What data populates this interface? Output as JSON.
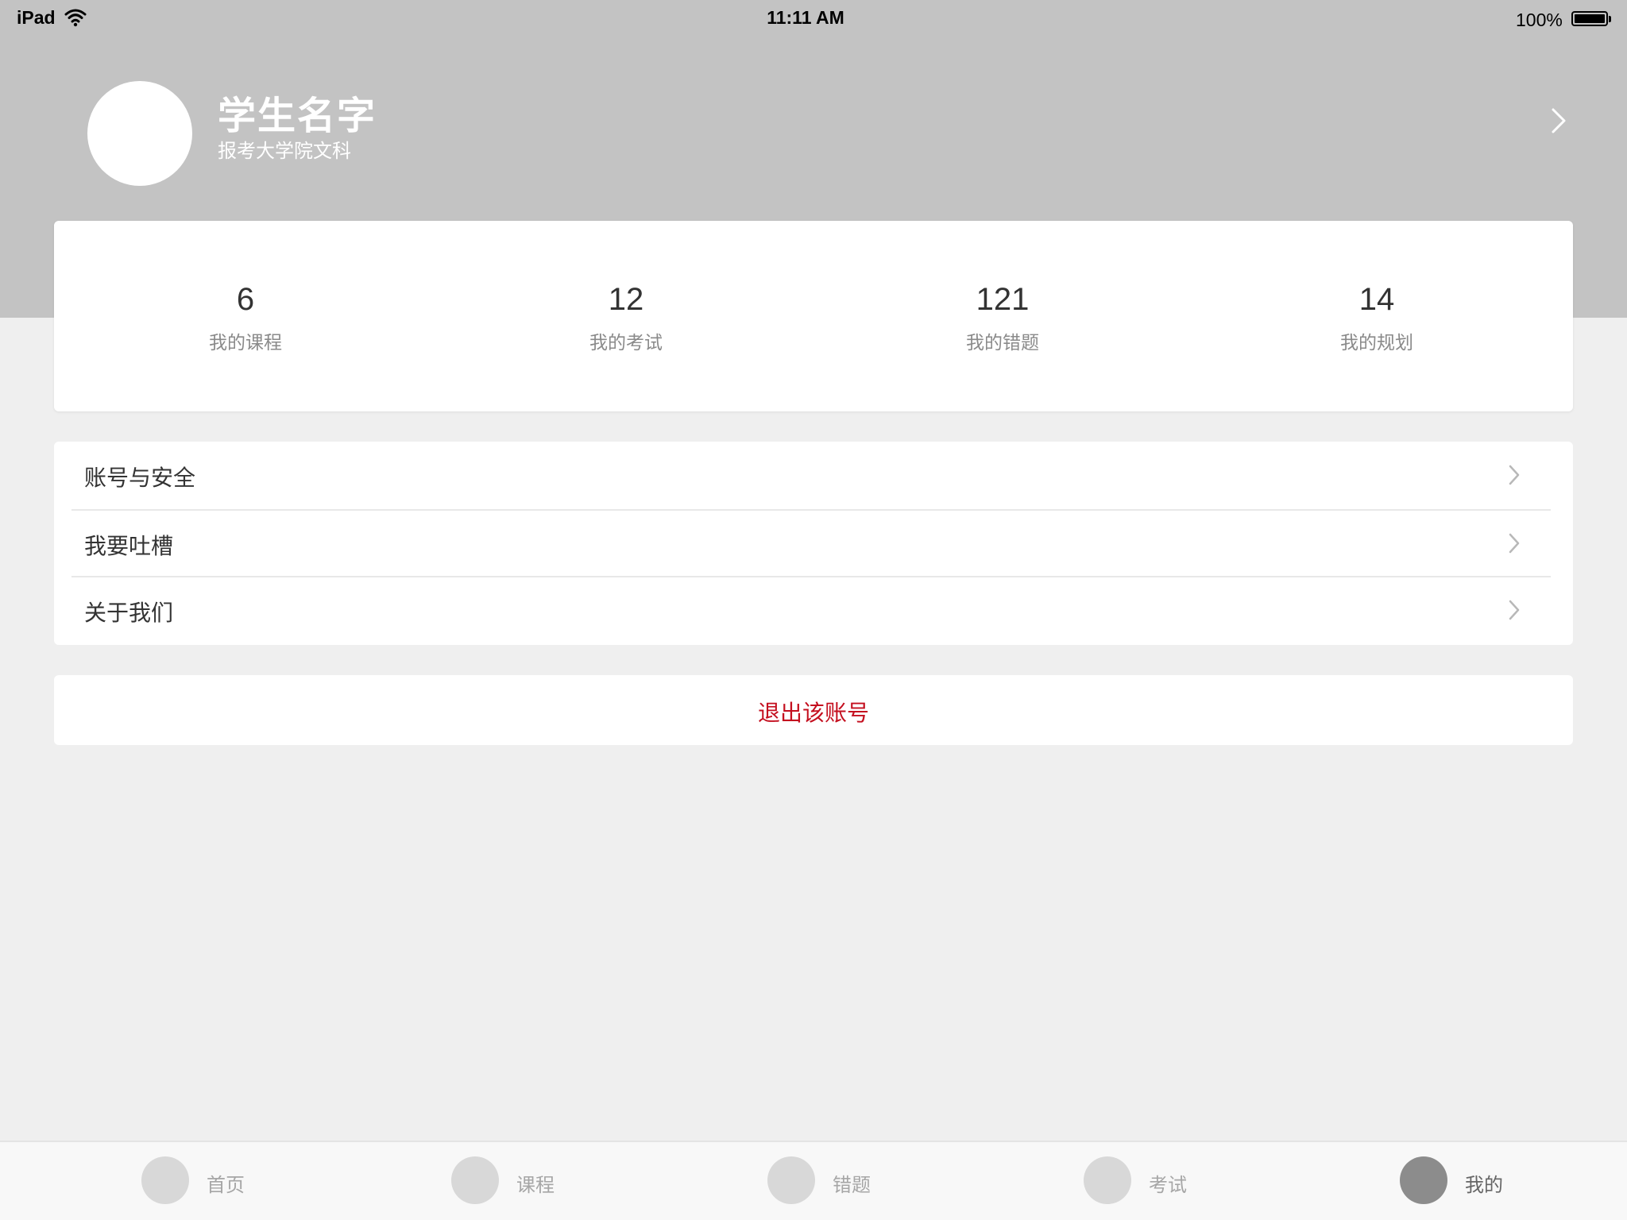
{
  "status_bar": {
    "device": "iPad",
    "time": "11:11 AM",
    "battery": "100%"
  },
  "profile": {
    "name": "学生名字",
    "subtitle": "报考大学院文科"
  },
  "stats": [
    {
      "value": "6",
      "label": "我的课程"
    },
    {
      "value": "12",
      "label": "我的考试"
    },
    {
      "value": "121",
      "label": "我的错题"
    },
    {
      "value": "14",
      "label": "我的规划"
    }
  ],
  "menu": [
    {
      "label": "账号与安全"
    },
    {
      "label": "我要吐槽"
    },
    {
      "label": "关于我们"
    }
  ],
  "logout": {
    "label": "退出该账号",
    "color": "#c40f1f"
  },
  "tabs": [
    {
      "label": "首页",
      "active": false
    },
    {
      "label": "课程",
      "active": false
    },
    {
      "label": "错题",
      "active": false
    },
    {
      "label": "考试",
      "active": false
    },
    {
      "label": "我的",
      "active": true
    }
  ],
  "colors": {
    "header_bg": "#c3c3c3",
    "page_bg": "#efefef",
    "accent_red": "#c40f1f"
  }
}
